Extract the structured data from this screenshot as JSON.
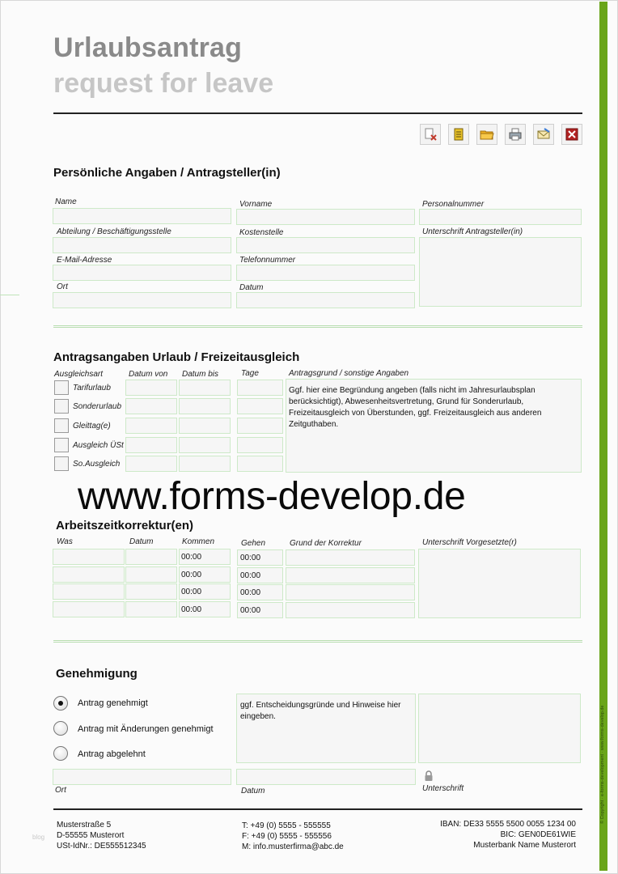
{
  "header": {
    "title": "Urlaubsantrag",
    "subtitle": "request for leave"
  },
  "toolbar": {
    "buttons": [
      {
        "icon": "clear-form-icon"
      },
      {
        "icon": "document-icon"
      },
      {
        "icon": "folder-open-icon"
      },
      {
        "icon": "print-icon"
      },
      {
        "icon": "email-icon"
      },
      {
        "icon": "close-icon"
      }
    ]
  },
  "personal": {
    "title": "Persönliche Angaben / Antragsteller(in)",
    "name_label": "Name",
    "vorname_label": "Vorname",
    "personalnummer_label": "Personalnummer",
    "abteilung_label": "Abteilung / Beschäftigungsstelle",
    "kostenstelle_label": "Kostenstelle",
    "unterschrift_label": "Unterschrift Antragsteller(in)",
    "email_label": "E-Mail-Adresse",
    "telefon_label": "Telefonnummer",
    "ort_label": "Ort",
    "datum_label": "Datum"
  },
  "leave": {
    "title": "Antragsangaben Urlaub / Freizeitausgleich",
    "col_art": "Ausgleichsart",
    "col_von": "Datum von",
    "col_bis": "Datum bis",
    "col_tage": "Tage",
    "col_grund": "Antragsgrund / sonstige Angaben",
    "types": [
      "Tarifurlaub",
      "Sonderurlaub",
      "Gleittag(e)",
      "Ausgleich ÜSt",
      "So.Ausgleich"
    ],
    "grund_placeholder": "Ggf. hier eine Begründung angeben (falls nicht im Jahresurlaubsplan berücksichtigt), Abwesenheitsvertretung, Grund für Sonderurlaub, Freizeitausgleich von Überstunden, ggf. Freizeitausgleich aus anderen Zeitguthaben."
  },
  "watermark": "www.forms-develop.de",
  "correction": {
    "title": "Arbeitszeitkorrektur(en)",
    "col_was": "Was",
    "col_datum": "Datum",
    "col_kommen": "Kommen",
    "col_gehen": "Gehen",
    "col_grund": "Grund der Korrektur",
    "col_unterschrift": "Unterschrift Vorgesetzte(r)",
    "rows": [
      {
        "kommen": "00:00",
        "gehen": "00:00"
      },
      {
        "kommen": "00:00",
        "gehen": "00:00"
      },
      {
        "kommen": "00:00",
        "gehen": "00:00"
      },
      {
        "kommen": "00:00",
        "gehen": "00:00"
      }
    ]
  },
  "approval": {
    "title": "Genehmigung",
    "options": [
      {
        "label": "Antrag genehmigt",
        "selected": true
      },
      {
        "label": "Antrag mit Änderungen genehmigt",
        "selected": false
      },
      {
        "label": "Antrag abgelehnt",
        "selected": false
      }
    ],
    "reason_placeholder": "ggf. Entscheidungsgründe und Hinweise hier eingeben.",
    "ort_label": "Ort",
    "datum_label": "Datum",
    "unterschrift_label": "Unterschrift"
  },
  "footer": {
    "address": [
      "Musterstraße 5",
      "D-55555 Musterort",
      "USt-IdNr.: DE555512345"
    ],
    "contact": [
      "T: +49 (0) 5555 - 555555",
      "F: +49 (0) 5555 - 555556",
      "M: info.musterfirma@abc.de"
    ],
    "bank": [
      "IBAN: DE33 5555 5500 0055 1234 00",
      "BIC: GEN0DE61WIE",
      "Musterbank Name Musterort"
    ]
  },
  "side_credit": "© Copyright · e-forms-development · www.forms-develop.de",
  "blog_mark": "blog",
  "colors": {
    "accent_green": "#6aa51a",
    "field_border": "#cde9c8",
    "title_gray": "#8a8a8a",
    "subtitle_gray": "#c6c6c6"
  }
}
